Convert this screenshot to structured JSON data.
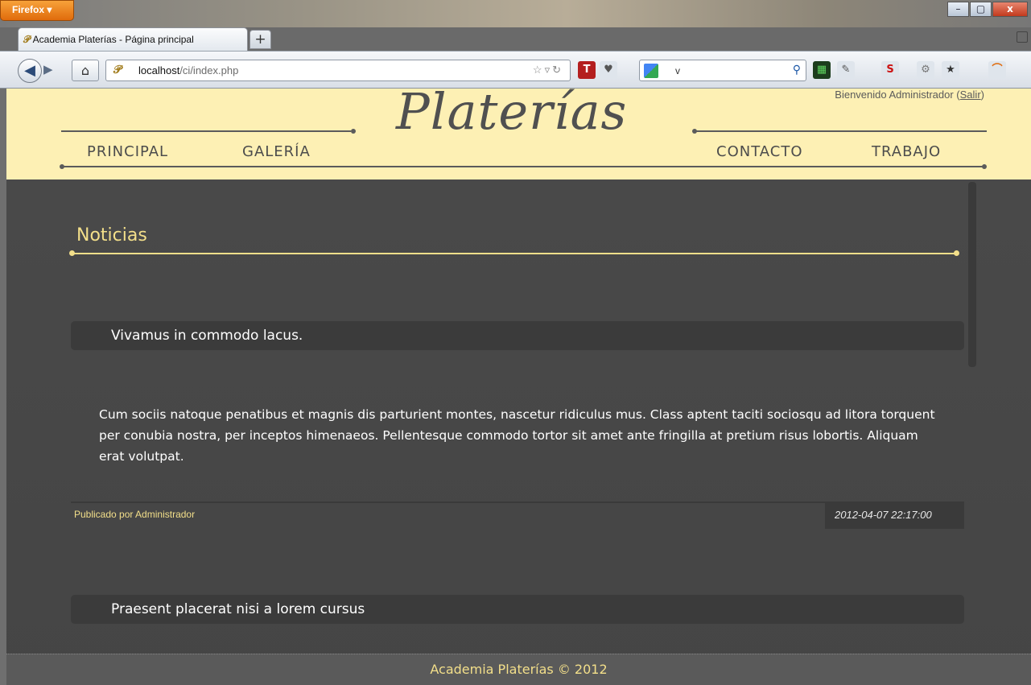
{
  "browser": {
    "menu_button": "Firefox ▾",
    "tab_title": "Academia Platerías - Página principal",
    "new_tab": "+",
    "url_host": "localhost",
    "url_path": "/ci/index.php",
    "search_text": "v",
    "window_buttons": [
      "–",
      "▢",
      "x"
    ]
  },
  "header": {
    "welcome_text": "Bienvenido Administrador (",
    "logout": "Salir",
    "welcome_close": ")",
    "logo": "Platerías",
    "nav": [
      "PRINCIPAL",
      "GALERÍA",
      "CONTACTO",
      "TRABAJO"
    ]
  },
  "content": {
    "section_title": "Noticias",
    "posts": [
      {
        "title": "Vivamus in commodo lacus.",
        "body": "Cum sociis natoque penatibus et magnis dis parturient montes, nascetur ridiculus mus. Class aptent taciti sociosqu ad litora torquent per conubia nostra, per inceptos himenaeos. Pellentesque commodo tortor sit amet ante fringilla at pretium risus lobortis. Aliquam erat volutpat.",
        "author": "Publicado por Administrador",
        "date": "2012-04-07 22:17:00"
      },
      {
        "title": "Praesent placerat nisi a lorem cursus"
      }
    ]
  },
  "footer": {
    "text": "Academia Platerías © 2012"
  },
  "colors": {
    "header_bg": "#fdf0b4",
    "accent_yellow": "#f3df8a",
    "page_bg": "#4a4a4a",
    "title_bar_bg": "#3b3b3b"
  },
  "icons": [
    "firefox-menu-icon",
    "back-icon",
    "forward-icon",
    "home-icon",
    "favicon-icon",
    "bookmark-star-icon",
    "reload-icon",
    "search-icon"
  ]
}
